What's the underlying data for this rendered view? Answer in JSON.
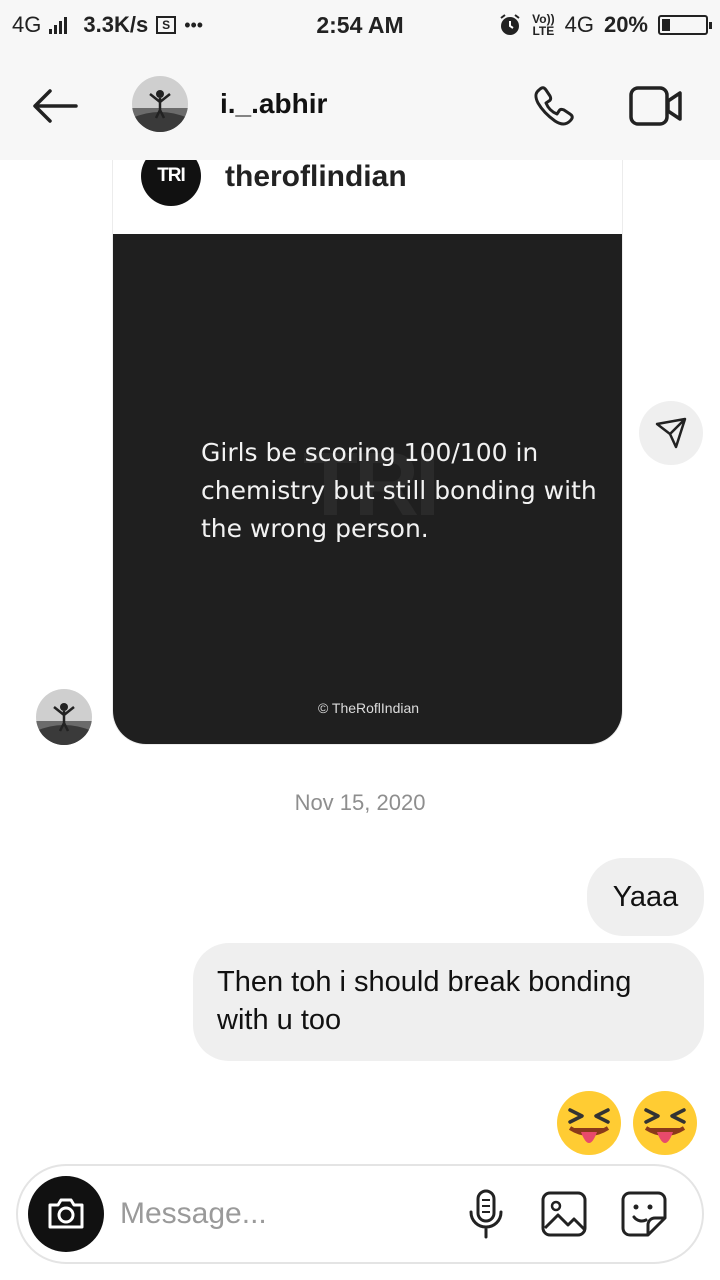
{
  "status_bar": {
    "network": "4G",
    "speed": "3.3K/s",
    "overflow": "•••",
    "time": "2:54 AM",
    "volte_top": "Vo))",
    "volte_bottom": "LTE",
    "network_right": "4G",
    "battery": "20%",
    "battery_level": 0.2
  },
  "header": {
    "username": "i._.abhir"
  },
  "shared_post": {
    "account_logo": "TRI",
    "account_name": "theroflindian",
    "watermark": "TRI",
    "text": "Girls be scoring 100/100 in chemistry but still bonding with the wrong person.",
    "credit": "© TheRoflIndian"
  },
  "date_separator": "Nov 15, 2020",
  "messages": [
    {
      "text": "Yaaa"
    },
    {
      "text": "Then toh i should break bonding with u too"
    }
  ],
  "emojis": [
    "squinting-face-with-tongue",
    "squinting-face-with-tongue"
  ],
  "composer": {
    "placeholder": "Message..."
  }
}
